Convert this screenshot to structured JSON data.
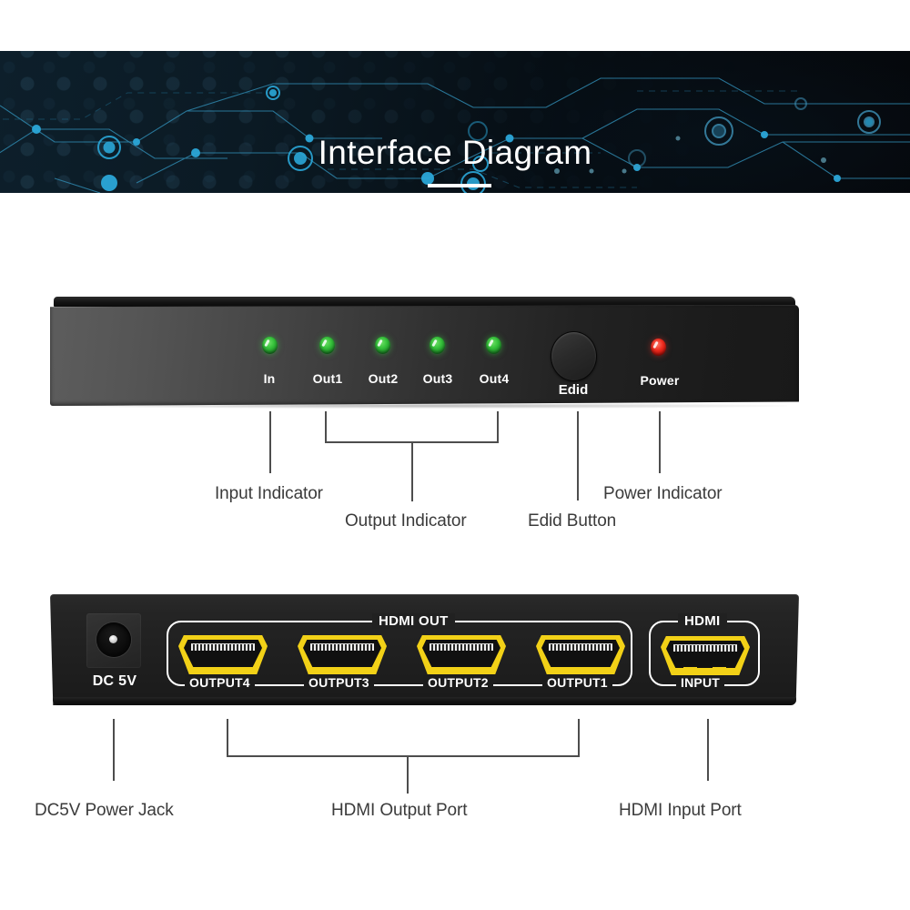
{
  "banner": {
    "title": "Interface Diagram",
    "bg_dark": "#0a141c",
    "accent": "#2ba7d8",
    "title_color": "#ffffff"
  },
  "front_panel": {
    "leds": [
      {
        "name": "In",
        "color": "#33bb33",
        "state": "on"
      },
      {
        "name": "Out1",
        "color": "#33bb33",
        "state": "on"
      },
      {
        "name": "Out2",
        "color": "#33bb33",
        "state": "on"
      },
      {
        "name": "Out3",
        "color": "#33bb33",
        "state": "on"
      },
      {
        "name": "Out4",
        "color": "#33bb33",
        "state": "on"
      }
    ],
    "edid_button_label": "Edid",
    "power_led_label": "Power",
    "power_led_color": "#e42a1d"
  },
  "rear_panel": {
    "dc_label": "DC 5V",
    "hdmi_out_group_label": "HDMI OUT",
    "hdmi_out_ports": [
      "OUTPUT4",
      "OUTPUT3",
      "OUTPUT2",
      "OUTPUT1"
    ],
    "hdmi_in_group_label": "HDMI",
    "hdmi_in_port_label": "INPUT",
    "port_color": "#f2d117"
  },
  "callouts": {
    "front": [
      {
        "label": "Input Indicator"
      },
      {
        "label": "Output Indicator"
      },
      {
        "label": "Edid Button"
      },
      {
        "label": "Power Indicator"
      }
    ],
    "rear": [
      {
        "label": "DC5V Power Jack"
      },
      {
        "label": "HDMI Output Port"
      },
      {
        "label": "HDMI Input Port"
      }
    ],
    "line_color": "#4d4d4d",
    "text_color": "#3b3b3b"
  }
}
